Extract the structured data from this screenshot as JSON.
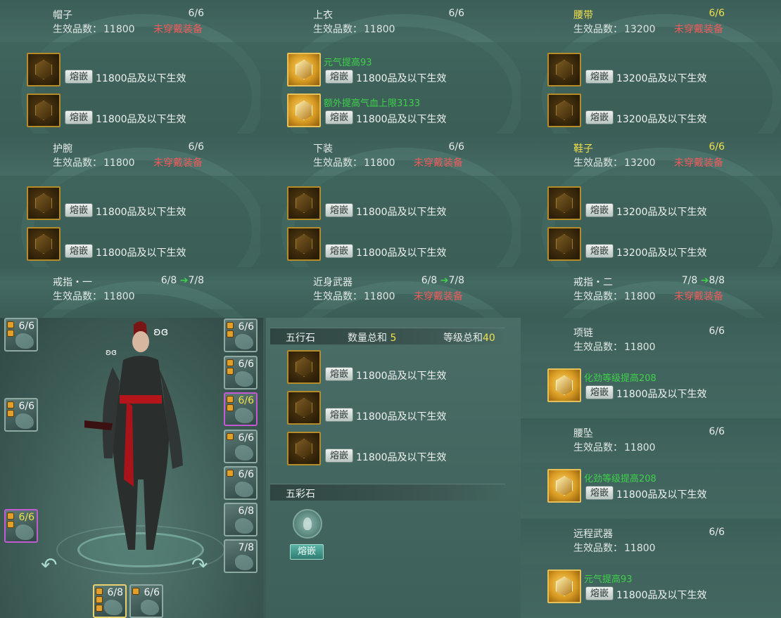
{
  "slots": {
    "hat": {
      "title": "帽子",
      "count": "6/6",
      "quality_label": "生效品数：",
      "quality": "11800",
      "warning": "未穿戴装备",
      "gold": false,
      "rows": [
        {
          "btn": "熔嵌",
          "req": "11800品及以下生效",
          "lit": false
        },
        {
          "btn": "熔嵌",
          "req": "11800品及以下生效",
          "lit": false
        }
      ]
    },
    "top": {
      "title": "上衣",
      "count": "6/6",
      "quality_label": "生效品数：",
      "quality": "11800",
      "warning": "",
      "gold": false,
      "rows": [
        {
          "btn": "熔嵌",
          "req": "11800品及以下生效",
          "bonus": "元气提高93",
          "lit": true
        },
        {
          "btn": "熔嵌",
          "req": "11800品及以下生效",
          "bonus": "额外提高气血上限3133",
          "lit": true
        }
      ]
    },
    "belt": {
      "title": "腰带",
      "count": "6/6",
      "quality_label": "生效品数：",
      "quality": "13200",
      "warning": "未穿戴装备",
      "gold": true,
      "rows": [
        {
          "btn": "熔嵌",
          "req": "13200品及以下生效",
          "lit": false
        },
        {
          "btn": "熔嵌",
          "req": "13200品及以下生效",
          "lit": false
        }
      ]
    },
    "wrist": {
      "title": "护腕",
      "count": "6/6",
      "quality_label": "生效品数：",
      "quality": "11800",
      "warning": "未穿戴装备",
      "gold": false,
      "rows": [
        {
          "btn": "熔嵌",
          "req": "11800品及以下生效",
          "lit": false
        },
        {
          "btn": "熔嵌",
          "req": "11800品及以下生效",
          "lit": false
        }
      ]
    },
    "bottom": {
      "title": "下装",
      "count": "6/6",
      "quality_label": "生效品数：",
      "quality": "11800",
      "warning": "未穿戴装备",
      "gold": false,
      "rows": [
        {
          "btn": "熔嵌",
          "req": "11800品及以下生效",
          "lit": false
        },
        {
          "btn": "熔嵌",
          "req": "11800品及以下生效",
          "lit": false
        }
      ]
    },
    "shoes": {
      "title": "鞋子",
      "count": "6/6",
      "quality_label": "生效品数：",
      "quality": "13200",
      "warning": "未穿戴装备",
      "gold": true,
      "rows": [
        {
          "btn": "熔嵌",
          "req": "13200品及以下生效",
          "lit": false
        },
        {
          "btn": "熔嵌",
          "req": "13200品及以下生效",
          "lit": false
        }
      ]
    },
    "ring1": {
      "title": "戒指・一",
      "count": "6/8",
      "upgrade": "7/8",
      "quality_label": "生效品数：",
      "quality": "11800",
      "warning": ""
    },
    "melee": {
      "title": "近身武器",
      "count": "6/8",
      "upgrade": "7/8",
      "quality_label": "生效品数：",
      "quality": "11800",
      "warning": "未穿戴装备"
    },
    "ring2": {
      "title": "戒指・二",
      "count": "7/8",
      "upgrade": "8/8",
      "quality_label": "生效品数：",
      "quality": "11800",
      "warning": "未穿戴装备"
    }
  },
  "accessories": [
    {
      "title": "项链",
      "count": "6/6",
      "quality_label": "生效品数：",
      "quality": "11800",
      "bonus": "化劲等级提高208",
      "btn": "熔嵌",
      "req": "11800品及以下生效"
    },
    {
      "title": "腰坠",
      "count": "6/6",
      "quality_label": "生效品数：",
      "quality": "11800",
      "bonus": "化劲等级提高208",
      "btn": "熔嵌",
      "req": "11800品及以下生效"
    },
    {
      "title": "远程武器",
      "count": "6/6",
      "quality_label": "生效品数：",
      "quality": "11800",
      "bonus": "元气提高93",
      "btn": "熔嵌",
      "req": "11800品及以下生效"
    }
  ],
  "wuxing": {
    "title": "五行石",
    "qty_label": "数量总和",
    "qty": "5",
    "lvl_label": "等级总和",
    "lvl": "40",
    "rows": [
      {
        "btn": "熔嵌",
        "req": "11800品及以下生效"
      },
      {
        "btn": "熔嵌",
        "req": "11800品及以下生效"
      },
      {
        "btn": "熔嵌",
        "req": "11800品及以下生效"
      }
    ]
  },
  "wucai": {
    "title": "五彩石",
    "btn": "熔嵌"
  },
  "equip_slots": {
    "left": [
      "6/6",
      "6/6",
      "6/6"
    ],
    "right": [
      "6/6",
      "6/6",
      "6/6",
      "6/6",
      "6/6",
      "6/8",
      "7/8"
    ],
    "bottom": [
      "6/8",
      "6/6"
    ]
  },
  "arrow": "➔",
  "colors": {
    "warning": "#ee5b5b",
    "bonus": "#3ed24a",
    "gold_title": "#f1e04c"
  }
}
